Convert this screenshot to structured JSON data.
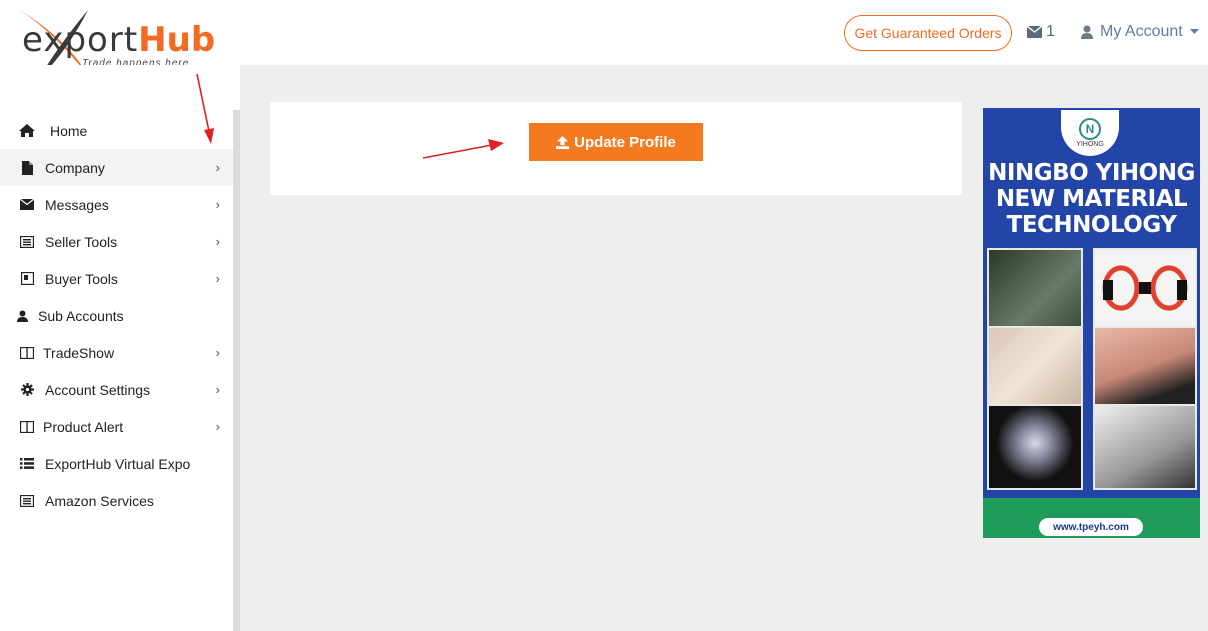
{
  "brand": {
    "name_prefix": "ex",
    "name_mid": "port",
    "name_hub": "Hub",
    "tagline": "Trade happens here."
  },
  "header": {
    "guaranteed_orders_label": "Get Guaranteed Orders",
    "mail_count": "1",
    "account_label": "My Account"
  },
  "sidebar": {
    "items": [
      {
        "label": "Home",
        "icon": "home-icon",
        "has_submenu": false
      },
      {
        "label": "Company",
        "icon": "file-icon",
        "has_submenu": true
      },
      {
        "label": "Messages",
        "icon": "envelope-icon",
        "has_submenu": true
      },
      {
        "label": "Seller Tools",
        "icon": "list-alt-icon",
        "has_submenu": true
      },
      {
        "label": "Buyer Tools",
        "icon": "book-icon",
        "has_submenu": true
      },
      {
        "label": "Sub Accounts",
        "icon": "user-icon",
        "has_submenu": false
      },
      {
        "label": "TradeShow",
        "icon": "columns-icon",
        "has_submenu": true
      },
      {
        "label": "Account Settings",
        "icon": "gear-icon",
        "has_submenu": true
      },
      {
        "label": "Product Alert",
        "icon": "columns-icon",
        "has_submenu": true
      },
      {
        "label": "ExportHub Virtual Expo",
        "icon": "list-icon",
        "has_submenu": false
      },
      {
        "label": "Amazon Services",
        "icon": "list-alt-icon",
        "has_submenu": false
      }
    ]
  },
  "main": {
    "update_profile_label": "Update Profile"
  },
  "ad": {
    "logo_text": "YIHONG",
    "title_line1": "NINGBO YIHONG",
    "title_line2": "NEW MATERIAL",
    "title_line3": "TECHNOLOGY",
    "url": "www.tpeyh.com"
  },
  "colors": {
    "accent": "#f26b21",
    "button": "#f47a1f",
    "account_link": "#5b7da6",
    "ad_blue": "#2345a8",
    "ad_green": "#1e9a5a",
    "annotation_arrow": "#e02020"
  }
}
